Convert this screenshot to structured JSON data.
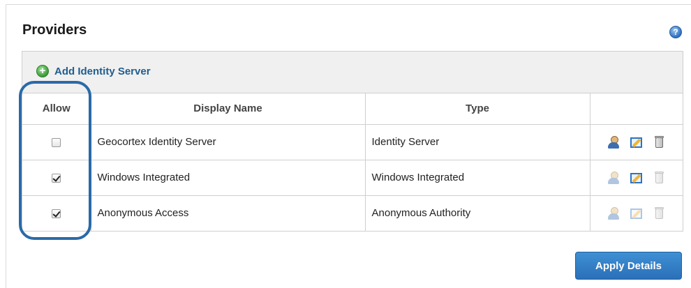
{
  "panel": {
    "title": "Providers",
    "help_icon": "help-icon"
  },
  "toolbar": {
    "add_label": "Add Identity Server",
    "add_icon": "plus-circle-icon"
  },
  "table": {
    "headers": {
      "allow": "Allow",
      "display_name": "Display Name",
      "type": "Type",
      "actions": ""
    },
    "rows": [
      {
        "allowed": false,
        "display_name": "Geocortex Identity Server",
        "type": "Identity Server",
        "actions_enabled": true
      },
      {
        "allowed": true,
        "display_name": "Windows Integrated",
        "type": "Windows Integrated",
        "actions_enabled": false
      },
      {
        "allowed": true,
        "display_name": "Anonymous Access",
        "type": "Anonymous Authority",
        "actions_enabled": false
      }
    ],
    "action_icons": [
      "user-icon",
      "edit-icon",
      "trash-icon"
    ]
  },
  "footer": {
    "apply_label": "Apply Details"
  },
  "colors": {
    "accent": "#2a70b8",
    "link": "#1f5d8f",
    "highlight_oval": "#2a6aa8"
  }
}
